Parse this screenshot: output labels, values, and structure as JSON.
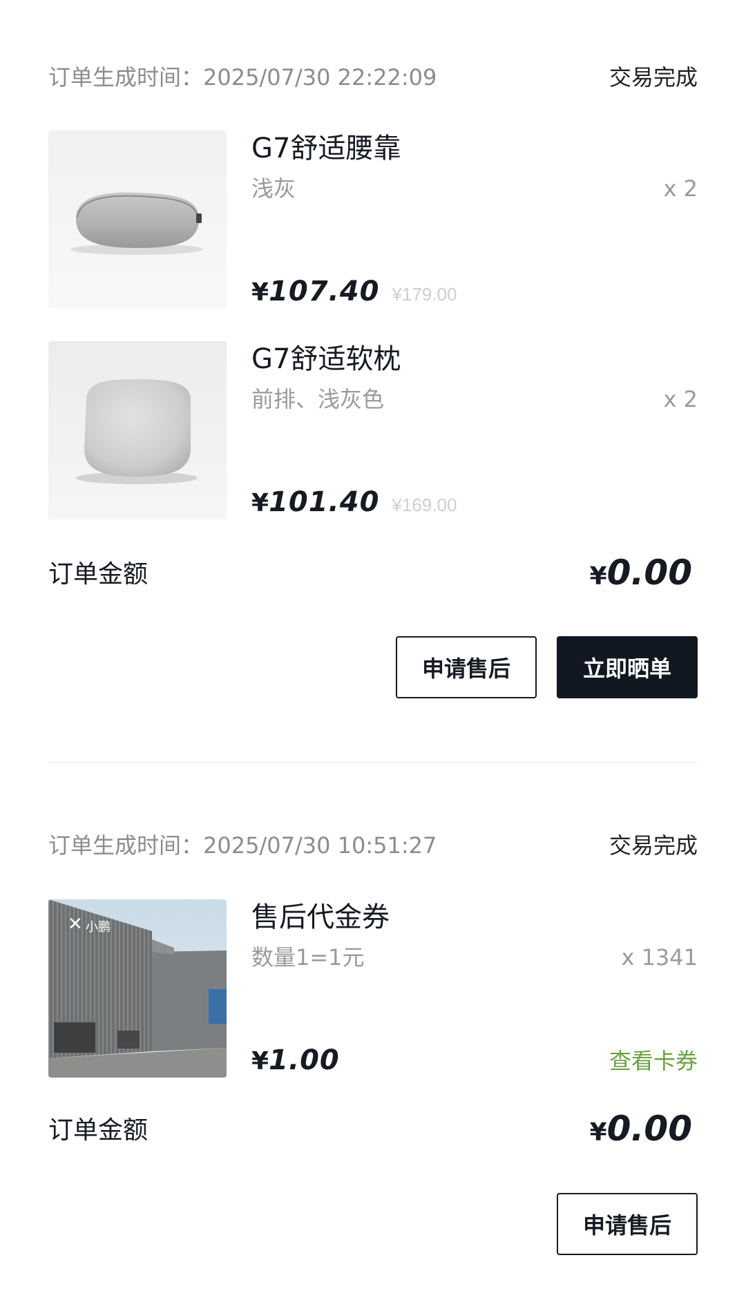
{
  "orders": [
    {
      "time_label": "订单生成时间：2025/07/30 22:22:09",
      "status": "交易完成",
      "items": [
        {
          "name": "G7舒适腰靠",
          "spec": "浅灰",
          "qty": "x 2",
          "price_symbol": "¥",
          "price": "107.40",
          "original_price": "¥179.00",
          "image": "lumbar-pillow-image"
        },
        {
          "name": "G7舒适软枕",
          "spec": "前排、浅灰色",
          "qty": "x 2",
          "price_symbol": "¥",
          "price": "101.40",
          "original_price": "¥169.00",
          "image": "headrest-pillow-image"
        }
      ],
      "total_label": "订单金额",
      "total_symbol": "¥",
      "total": "0.00",
      "buttons": {
        "after_sale": "申请售后",
        "share": "立即晒单"
      }
    },
    {
      "time_label": "订单生成时间：2025/07/30 10:51:27",
      "status": "交易完成",
      "items": [
        {
          "name": "售后代金券",
          "spec": "数量1=1元",
          "qty": "x 1341",
          "price_symbol": "¥",
          "price": "1.00",
          "link": "查看卡券",
          "image": "service-center-building-image",
          "logo_text": "小鹏"
        }
      ],
      "total_label": "订单金额",
      "total_symbol": "¥",
      "total": "0.00",
      "buttons": {
        "after_sale": "申请售后"
      }
    }
  ],
  "colors": {
    "link_green": "#6aa043",
    "dark_button": "#111822",
    "muted_text": "#8c8c8c"
  }
}
